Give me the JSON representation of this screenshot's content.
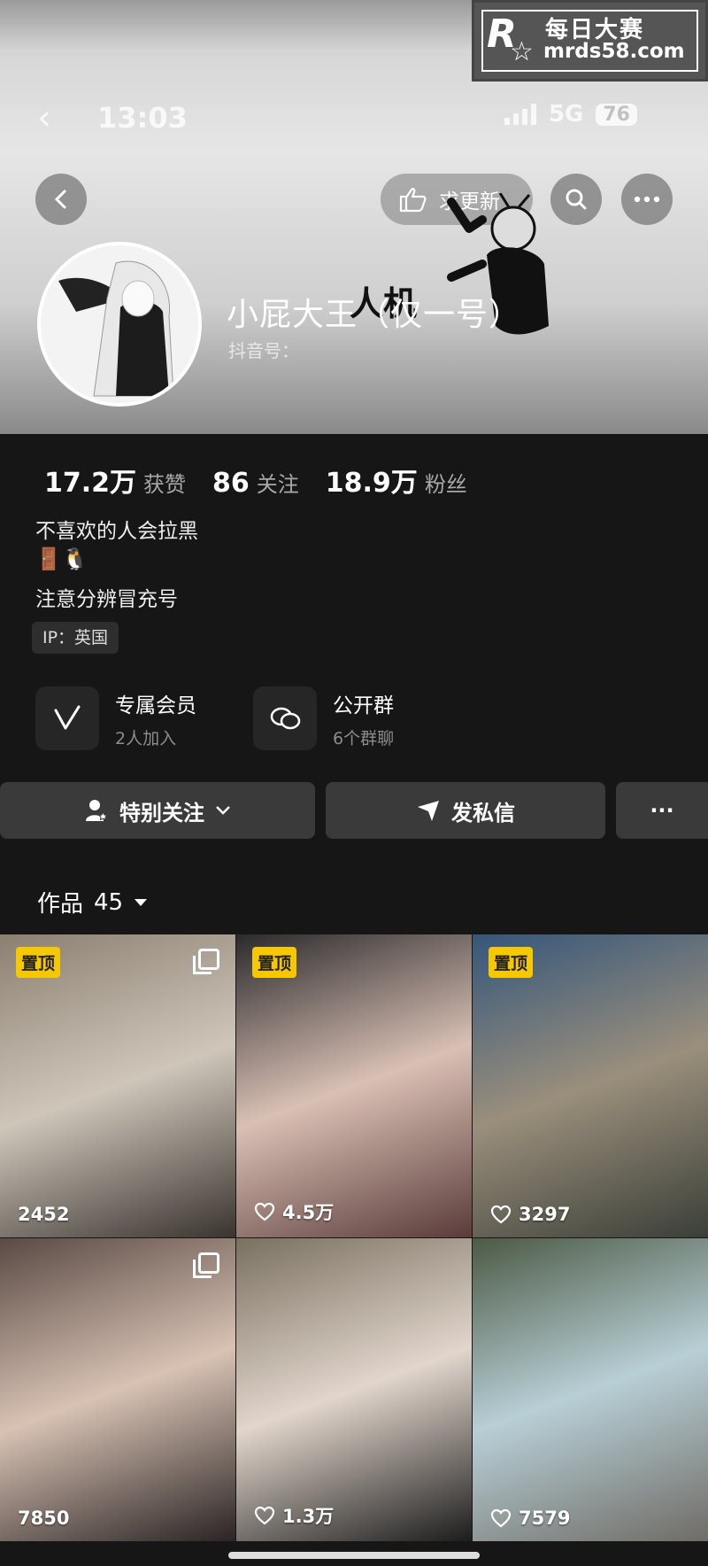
{
  "watermark": {
    "logo_letter": "R",
    "cn_text": "每日大赛",
    "url": "mrds58.com"
  },
  "status_bar": {
    "time": "13:03",
    "network": "5G",
    "battery": "76"
  },
  "header": {
    "request_update_label": "求更新"
  },
  "profile": {
    "nickname": "小屁大王（仅一号）",
    "douyin_id_label": "抖音号：",
    "doodle_text": "人机"
  },
  "stats": [
    {
      "value": "17.2万",
      "label": "获赞"
    },
    {
      "value": "86",
      "label": "关注"
    },
    {
      "value": "18.9万",
      "label": "粉丝"
    }
  ],
  "bio": {
    "line1": "不喜欢的人会拉黑",
    "line2_emoji": "🚪🐧",
    "line3": "注意分辨冒充号"
  },
  "ip_tag": "IP：英国",
  "features": [
    {
      "title": "专属会员",
      "subtitle": "2人加入",
      "icon": "v-badge-icon"
    },
    {
      "title": "公开群",
      "subtitle": "6个群聊",
      "icon": "chat-bubbles-icon"
    }
  ],
  "actions": {
    "follow_label": "特别关注",
    "message_label": "发私信",
    "more_label": "···"
  },
  "works": {
    "tab_label": "作品",
    "count": "45"
  },
  "grid_items": [
    {
      "pinned": true,
      "pin_label": "置顶",
      "multi": true,
      "likes": "2452",
      "show_heart": false,
      "colors": [
        "#8b7f70",
        "#cfc6ba",
        "#3a3430"
      ]
    },
    {
      "pinned": true,
      "pin_label": "置顶",
      "multi": false,
      "likes": "4.5万",
      "show_heart": true,
      "colors": [
        "#2b2a2c",
        "#d9c0b4",
        "#5a3b3a"
      ]
    },
    {
      "pinned": true,
      "pin_label": "置顶",
      "multi": false,
      "likes": "3297",
      "show_heart": true,
      "colors": [
        "#35567a",
        "#9a8f7c",
        "#3b3f38"
      ]
    },
    {
      "pinned": false,
      "pin_label": "",
      "multi": true,
      "likes": "7850",
      "show_heart": false,
      "colors": [
        "#5a4a44",
        "#d8c2b4",
        "#2a2424"
      ]
    },
    {
      "pinned": false,
      "pin_label": "",
      "multi": false,
      "likes": "1.3万",
      "show_heart": true,
      "colors": [
        "#7a7060",
        "#e2d6cc",
        "#1c1c1c"
      ]
    },
    {
      "pinned": false,
      "pin_label": "",
      "multi": false,
      "likes": "7579",
      "show_heart": true,
      "colors": [
        "#4c5a45",
        "#b8cfd6",
        "#6f6c66"
      ]
    }
  ]
}
